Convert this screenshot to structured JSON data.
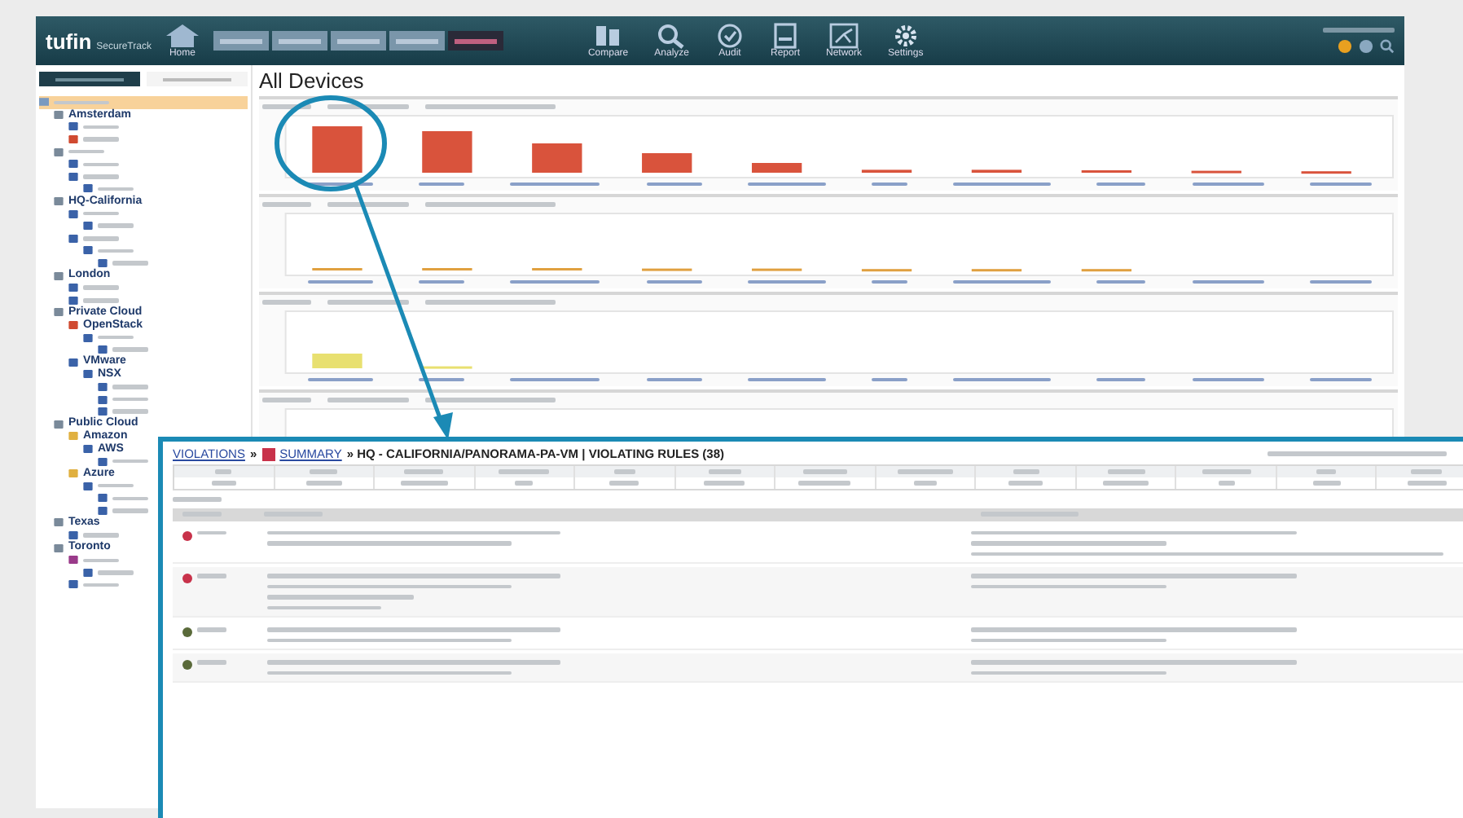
{
  "header": {
    "logo": "tufin",
    "product": "SecureTrack",
    "home": "Home",
    "nav_tabs": [
      {
        "selected": false
      },
      {
        "selected": false
      },
      {
        "selected": false
      },
      {
        "selected": false
      },
      {
        "selected": true
      }
    ],
    "tools": [
      {
        "kind": "compare",
        "label": "Compare"
      },
      {
        "kind": "analyze",
        "label": "Analyze"
      },
      {
        "kind": "audit",
        "label": "Audit"
      },
      {
        "kind": "report",
        "label": "Report"
      },
      {
        "kind": "network",
        "label": "Network"
      },
      {
        "kind": "settings",
        "label": "Settings"
      }
    ]
  },
  "sidebar": {
    "tabs": [
      {
        "selected": true
      },
      {
        "selected": false
      }
    ],
    "tree": {
      "selected": true,
      "children": [
        {
          "label": "Amsterdam",
          "kind": "site",
          "children": [
            {
              "kind": "device"
            },
            {
              "kind": "firewall"
            }
          ]
        },
        {
          "kind": "site",
          "children": [
            {
              "kind": "device"
            },
            {
              "kind": "device",
              "children": [
                {
                  "kind": "device"
                }
              ]
            }
          ]
        },
        {
          "label": "HQ-California",
          "kind": "site",
          "children": [
            {
              "kind": "device",
              "children": [
                {
                  "kind": "device"
                }
              ]
            },
            {
              "kind": "device",
              "children": [
                {
                  "kind": "device",
                  "children": [
                    {
                      "kind": "device"
                    }
                  ]
                }
              ]
            }
          ]
        },
        {
          "label": "London",
          "kind": "site",
          "children": [
            {
              "kind": "device"
            },
            {
              "kind": "device"
            }
          ]
        },
        {
          "label": "Private Cloud",
          "kind": "site",
          "children": [
            {
              "label": "OpenStack",
              "kind": "firewall",
              "children": [
                {
                  "kind": "device",
                  "children": [
                    {
                      "kind": "device"
                    }
                  ]
                }
              ]
            },
            {
              "label": "VMware",
              "kind": "device",
              "children": [
                {
                  "label": "NSX",
                  "kind": "device",
                  "children": [
                    {
                      "kind": "device"
                    },
                    {
                      "kind": "device"
                    },
                    {
                      "kind": "device"
                    }
                  ]
                }
              ]
            }
          ]
        },
        {
          "label": "Public Cloud",
          "kind": "site",
          "children": [
            {
              "label": "Amazon",
              "kind": "cloud",
              "children": [
                {
                  "label": "AWS",
                  "kind": "device",
                  "children": [
                    {
                      "kind": "device"
                    }
                  ]
                }
              ]
            },
            {
              "label": "Azure",
              "kind": "cloud",
              "children": [
                {
                  "kind": "device",
                  "children": [
                    {
                      "kind": "device"
                    },
                    {
                      "kind": "device"
                    }
                  ]
                }
              ]
            }
          ]
        },
        {
          "label": "Texas",
          "kind": "site",
          "children": [
            {
              "kind": "device"
            }
          ]
        },
        {
          "label": "Toronto",
          "kind": "site",
          "children": [
            {
              "kind": "switch",
              "children": [
                {
                  "kind": "device"
                }
              ]
            },
            {
              "kind": "device"
            }
          ]
        }
      ]
    }
  },
  "main": {
    "title": "All Devices",
    "panels": [
      {
        "kind": "critical"
      },
      {
        "kind": "high"
      },
      {
        "kind": "medium"
      },
      {
        "kind": "low"
      }
    ]
  },
  "popup": {
    "crumb_1": "VIOLATIONS",
    "sep": "»",
    "crumb_2": "SUMMARY",
    "path": "» HQ - CALIFORNIA/PANORAMA-PA-VM | VIOLATING RULES (38)",
    "violations": [
      {
        "color": "#c8324a"
      },
      {
        "color": "#c8324a"
      },
      {
        "color": "#5a6a3a"
      },
      {
        "color": "#5a6a3a"
      }
    ]
  }
}
